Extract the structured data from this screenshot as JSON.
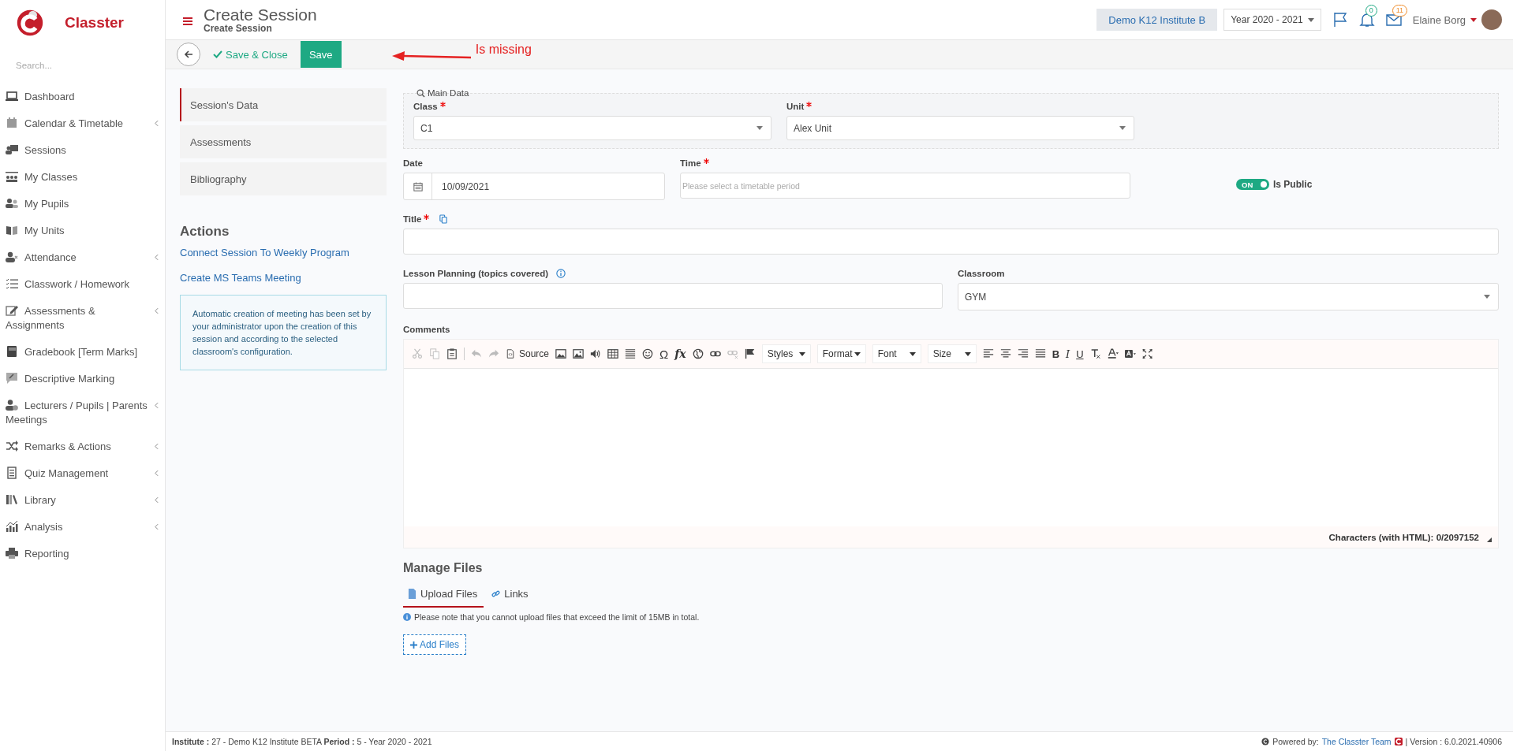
{
  "brand": {
    "name": "Classter"
  },
  "sidebar": {
    "search_placeholder": "Search...",
    "items": [
      {
        "label": "Dashboard",
        "has_submenu": false
      },
      {
        "label": "Calendar & Timetable",
        "has_submenu": true
      },
      {
        "label": "Sessions",
        "has_submenu": false
      },
      {
        "label": "My Classes",
        "has_submenu": false
      },
      {
        "label": "My Pupils",
        "has_submenu": false
      },
      {
        "label": "My Units",
        "has_submenu": false
      },
      {
        "label": "Attendance",
        "has_submenu": true
      },
      {
        "label": "Classwork / Homework",
        "has_submenu": false
      },
      {
        "label": "Assessments & Assignments",
        "has_submenu": true
      },
      {
        "label": "Gradebook [Term Marks]",
        "has_submenu": false
      },
      {
        "label": "Descriptive Marking",
        "has_submenu": false
      },
      {
        "label": "Lecturers / Pupils | Parents Meetings",
        "has_submenu": true
      },
      {
        "label": "Remarks & Actions",
        "has_submenu": true
      },
      {
        "label": "Quiz Management",
        "has_submenu": true
      },
      {
        "label": "Library",
        "has_submenu": true
      },
      {
        "label": "Analysis",
        "has_submenu": true
      },
      {
        "label": "Reporting",
        "has_submenu": false
      }
    ]
  },
  "header": {
    "title": "Create Session",
    "subtitle": "Create Session",
    "institute": "Demo K12 Institute B",
    "year": "Year 2020 - 2021",
    "notifications": "0",
    "messages": "11",
    "user": "Elaine Borg"
  },
  "toolbar": {
    "save_close": "Save & Close",
    "save": "Save"
  },
  "annotation": {
    "text": "Is missing"
  },
  "form_tabs": [
    {
      "label": "Session's Data",
      "selected": true
    },
    {
      "label": "Assessments",
      "selected": false
    },
    {
      "label": "Bibliography",
      "selected": false
    }
  ],
  "actions": {
    "title": "Actions",
    "links": [
      "Connect Session To Weekly Program",
      "Create MS Teams Meeting"
    ],
    "note": "Automatic creation of meeting has been set by your administrator upon the creation of this session and according to the selected classroom's configuration."
  },
  "main_data": {
    "legend": "Main Data",
    "fields": [
      {
        "label": "Class",
        "required": true,
        "value": "C1"
      },
      {
        "label": "Unit",
        "required": true,
        "value": "Alex Unit"
      }
    ]
  },
  "date": {
    "label": "Date",
    "value": "10/09/2021"
  },
  "time": {
    "label": "Time",
    "required": true,
    "placeholder": "Please select a timetable period"
  },
  "is_public": {
    "label": "Is Public",
    "on": true,
    "on_text": "ON"
  },
  "title_field": {
    "label": "Title",
    "required": true
  },
  "lesson_planning": {
    "label": "Lesson Planning (topics covered)"
  },
  "classroom": {
    "label": "Classroom",
    "value": "GYM"
  },
  "comments": {
    "label": "Comments",
    "source": "Source",
    "omega": "Ω",
    "fx": "fx",
    "dropdowns": [
      "Styles",
      "Format",
      "Font",
      "Size"
    ],
    "letters": [
      "B",
      "I",
      "U"
    ],
    "char_count": "Characters (with HTML): 0/2097152"
  },
  "files": {
    "title": "Manage Files",
    "tabs": [
      {
        "label": "Upload Files",
        "selected": true
      },
      {
        "label": "Links",
        "selected": false
      }
    ],
    "note": "Please note that you cannot upload files that exceed the limit of 15MB in total.",
    "add": "Add Files"
  },
  "footer": {
    "info": "**Institute :** 27 - Demo K12 Institute BETA **Period :** 5 - Year 2020 - 2021",
    "powered": "Powered by:",
    "team": "The Classter Team",
    "version": "| Version : 6.0.2021.40906"
  }
}
